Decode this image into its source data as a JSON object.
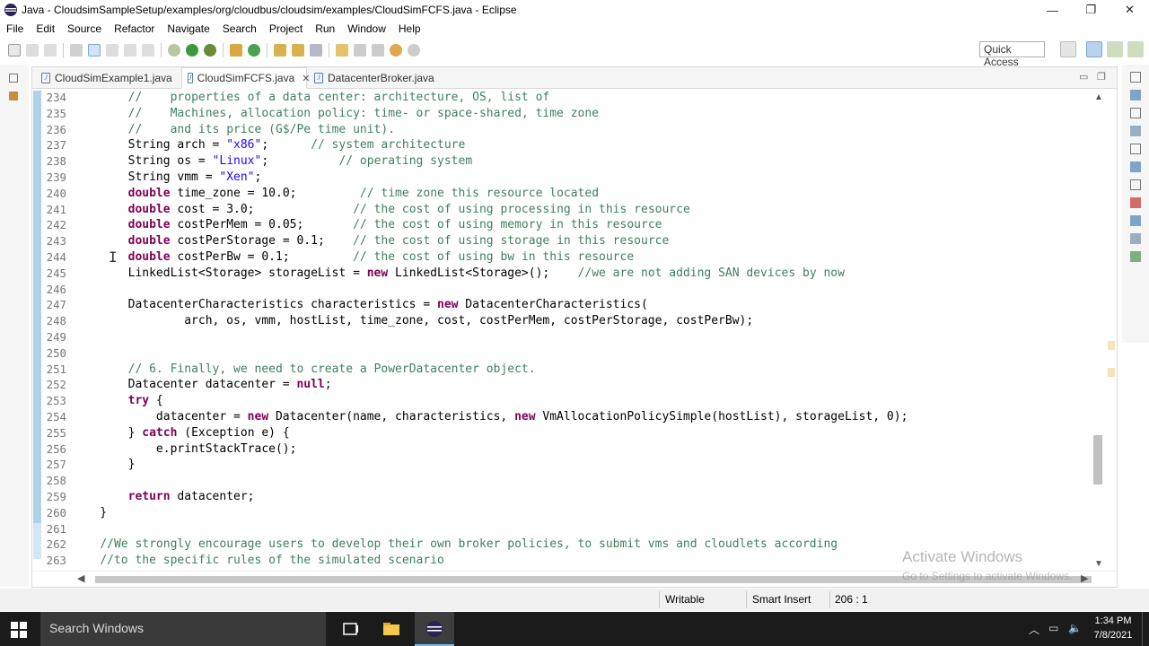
{
  "window": {
    "title": "Java - CloudsimSampleSetup/examples/org/cloudbus/cloudsim/examples/CloudSimFCFS.java - Eclipse",
    "controls": {
      "minimize": "—",
      "restore": "❐",
      "close": "✕"
    }
  },
  "menu": [
    "File",
    "Edit",
    "Source",
    "Refactor",
    "Navigate",
    "Search",
    "Project",
    "Run",
    "Window",
    "Help"
  ],
  "quick_access": "Quick Access",
  "tabs": [
    {
      "label": "CloudSimExample1.java",
      "active": false
    },
    {
      "label": "CloudSimFCFS.java",
      "active": true,
      "close": "✕"
    },
    {
      "label": "DatacenterBroker.java",
      "active": false
    }
  ],
  "code_lines": [
    {
      "num": "234",
      "text": "        //    properties of a data center: architecture, OS, list of"
    },
    {
      "num": "235",
      "text": "        //    Machines, allocation policy: time- or space-shared, time zone"
    },
    {
      "num": "236",
      "text": "        //    and its price (G$/Pe time unit)."
    },
    {
      "num": "237",
      "text": "        String arch = \"x86\";      // system architecture"
    },
    {
      "num": "238",
      "text": "        String os = \"Linux\";          // operating system"
    },
    {
      "num": "239",
      "text": "        String vmm = \"Xen\";"
    },
    {
      "num": "240",
      "text": "        double time_zone = 10.0;         // time zone this resource located"
    },
    {
      "num": "241",
      "text": "        double cost = 3.0;              // the cost of using processing in this resource"
    },
    {
      "num": "242",
      "text": "        double costPerMem = 0.05;       // the cost of using memory in this resource"
    },
    {
      "num": "243",
      "text": "        double costPerStorage = 0.1;    // the cost of using storage in this resource"
    },
    {
      "num": "244",
      "text": "        double costPerBw = 0.1;         // the cost of using bw in this resource"
    },
    {
      "num": "245",
      "text": "        LinkedList<Storage> storageList = new LinkedList<Storage>();    //we are not adding SAN devices by now"
    },
    {
      "num": "246",
      "text": ""
    },
    {
      "num": "247",
      "text": "        DatacenterCharacteristics characteristics = new DatacenterCharacteristics("
    },
    {
      "num": "248",
      "text": "                arch, os, vmm, hostList, time_zone, cost, costPerMem, costPerStorage, costPerBw);"
    },
    {
      "num": "249",
      "text": ""
    },
    {
      "num": "250",
      "text": ""
    },
    {
      "num": "251",
      "text": "        // 6. Finally, we need to create a PowerDatacenter object."
    },
    {
      "num": "252",
      "text": "        Datacenter datacenter = null;"
    },
    {
      "num": "253",
      "text": "        try {"
    },
    {
      "num": "254",
      "text": "            datacenter = new Datacenter(name, characteristics, new VmAllocationPolicySimple(hostList), storageList, 0);"
    },
    {
      "num": "255",
      "text": "        } catch (Exception e) {"
    },
    {
      "num": "256",
      "text": "            e.printStackTrace();"
    },
    {
      "num": "257",
      "text": "        }"
    },
    {
      "num": "258",
      "text": ""
    },
    {
      "num": "259",
      "text": "        return datacenter;"
    },
    {
      "num": "260",
      "text": "    }"
    },
    {
      "num": "261",
      "text": ""
    },
    {
      "num": "262",
      "text": "    //We strongly encourage users to develop their own broker policies, to submit vms and cloudlets according"
    },
    {
      "num": "263",
      "text": "    //to the specific rules of the simulated scenario"
    }
  ],
  "watermark": {
    "line1": "Activate Windows",
    "line2": "Go to Settings to activate Windows."
  },
  "status": {
    "writable": "Writable",
    "insert_mode": "Smart Insert",
    "position": "206 : 1"
  },
  "taskbar": {
    "search_placeholder": "Search Windows",
    "time": "1:34 PM",
    "date": "7/8/2021"
  },
  "colors": {
    "keyword": "#7f0055",
    "comment": "#3f7f5f",
    "string": "#2a00ff",
    "taskbar": "#1b1b1b"
  }
}
